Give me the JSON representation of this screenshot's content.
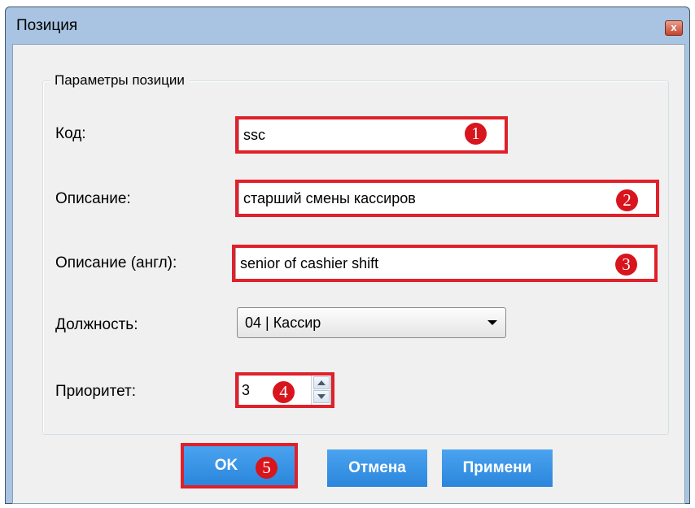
{
  "window": {
    "title": "Позиция",
    "close_glyph": "x"
  },
  "group": {
    "title": "Параметры позиции"
  },
  "fields": {
    "code": {
      "label": "Код:",
      "value": "ssc",
      "badge": "1"
    },
    "description": {
      "label": "Описание:",
      "value": "старший смены кассиров",
      "badge": "2"
    },
    "description_en": {
      "label": "Описание (англ):",
      "value": "senior of cashier shift",
      "badge": "3"
    },
    "position": {
      "label": "Должность:",
      "value": "04 | Кассир"
    },
    "priority": {
      "label": "Приоритет:",
      "value": "3",
      "badge": "4"
    }
  },
  "buttons": {
    "ok": {
      "label": "OK",
      "badge": "5"
    },
    "cancel": {
      "label": "Отмена"
    },
    "apply": {
      "label": "Примени"
    }
  },
  "colors": {
    "highlight": "#e0202a",
    "badge": "#d8141c",
    "button": "#3a96e6",
    "title_bar": "#a9c4e2"
  }
}
